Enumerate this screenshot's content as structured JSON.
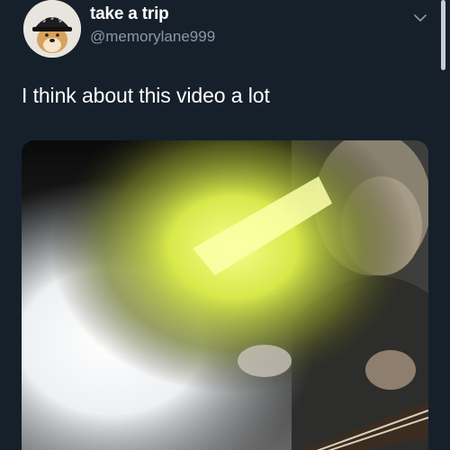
{
  "tweet": {
    "display_name": "take a trip",
    "handle": "@memorylane999",
    "text": "I think about this video a lot"
  },
  "icons": {
    "avatar": "dog-with-hat-avatar",
    "menu": "chevron-down-icon"
  },
  "colors": {
    "background": "#15202b",
    "primary_text": "#ffffff",
    "secondary_text": "#8899a6"
  }
}
